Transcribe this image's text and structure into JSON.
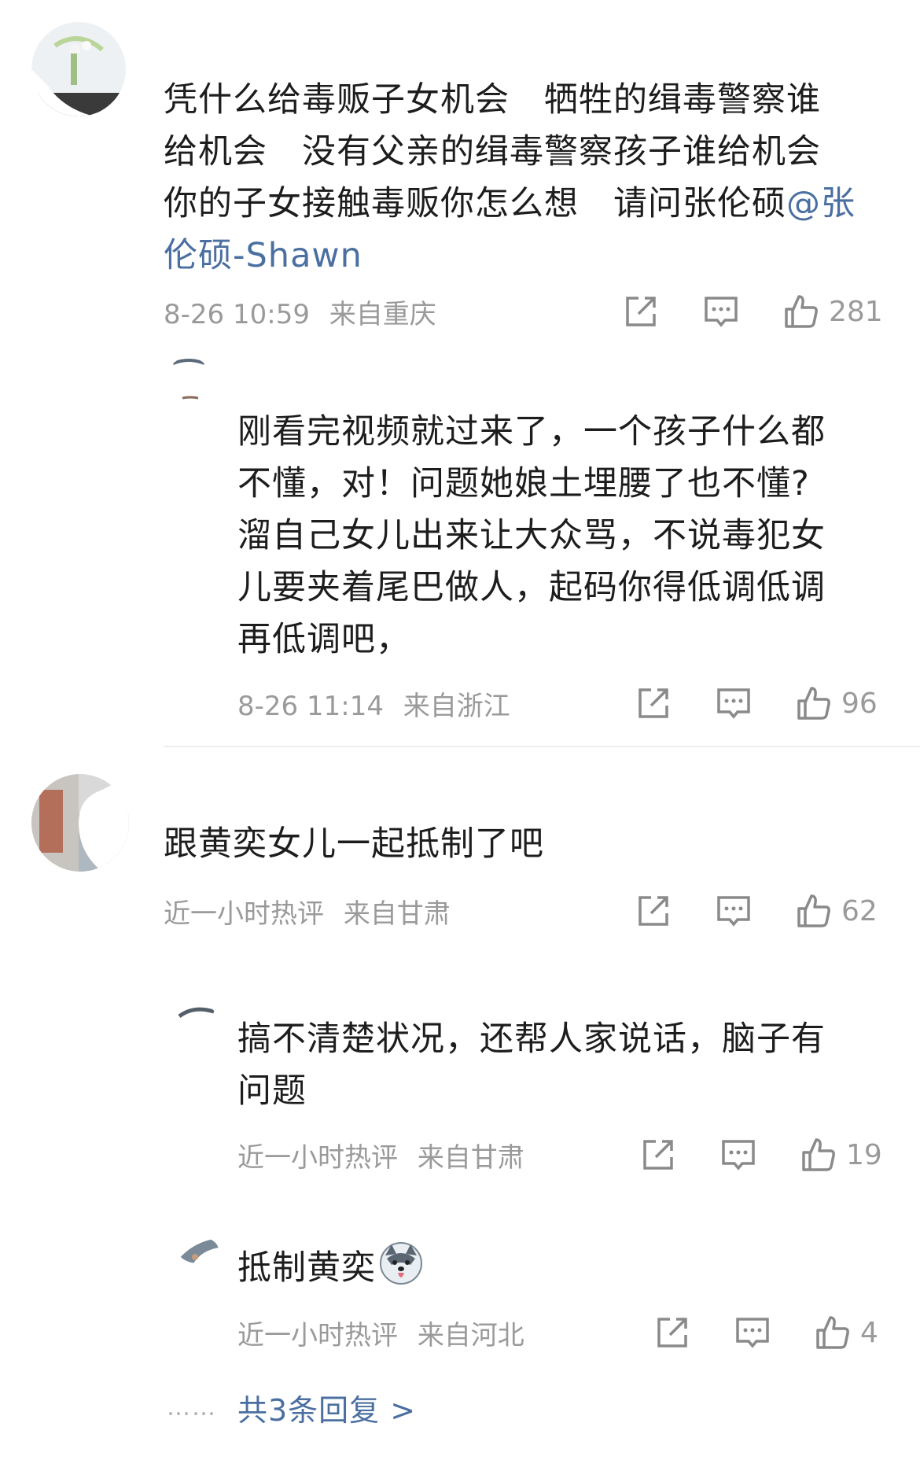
{
  "comments": [
    {
      "text_lines": [
        "凭什么给毒贩子女机会　牺牲的缉毒警察谁",
        "给机会　没有父亲的缉毒警察孩子谁给机会",
        "你的子女接触毒贩你怎么想　请问张伦硕"
      ],
      "mention_tail": "@张",
      "mention_line2": "伦硕-Shawn",
      "time": "8-26 10:59",
      "location": "来自重庆",
      "likes": "281"
    },
    {
      "text_lines": [
        "刚看完视频就过来了，一个孩子什么都",
        "不懂，对！问题她娘土埋腰了也不懂?",
        "溜自己女儿出来让大众骂，不说毒犯女",
        "儿要夹着尾巴做人，起码你得低调低调",
        "再低调吧，"
      ],
      "time": "8-26 11:14",
      "location": "来自浙江",
      "likes": "96"
    },
    {
      "text_lines": [
        "跟黄奕女儿一起抵制了吧"
      ],
      "time": "近一小时热评",
      "location": "来自甘肃",
      "likes": "62"
    },
    {
      "text_lines": [
        "搞不清楚状况，还帮人家说话，脑子有",
        "问题"
      ],
      "time": "近一小时热评",
      "location": "来自甘肃",
      "likes": "19"
    },
    {
      "text_lines": [
        "抵制黄奕"
      ],
      "time": "近一小时热评",
      "location": "来自河北",
      "likes": "4"
    }
  ],
  "more_replies": {
    "dots": "……",
    "label": "共3条回复 >"
  },
  "colors": {
    "text": "#1d1d1d",
    "meta": "#9a9a9a",
    "link": "#4a6fa0",
    "divider": "#eeeeee"
  },
  "icons": [
    "share-icon",
    "comment-icon",
    "like-icon",
    "husky-emoji"
  ]
}
